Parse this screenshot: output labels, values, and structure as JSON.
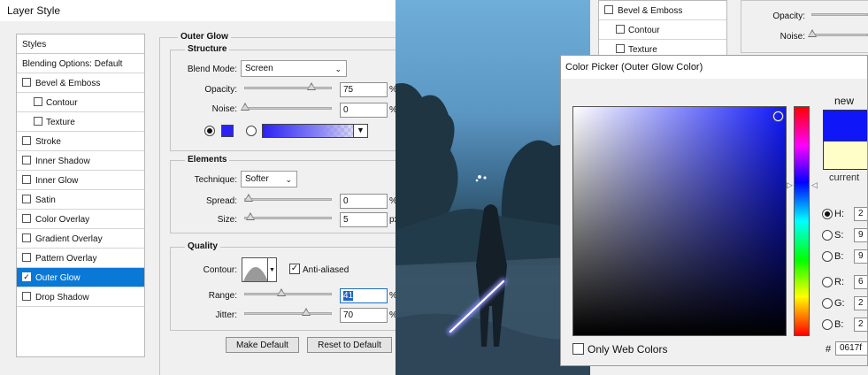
{
  "layer_style": {
    "title": "Layer Style",
    "styles_header": "Styles",
    "styles": [
      {
        "label": "Blending Options: Default"
      },
      {
        "label": "Bevel & Emboss",
        "checked": false
      },
      {
        "label": "Contour",
        "checked": false
      },
      {
        "label": "Texture",
        "checked": false
      },
      {
        "label": "Stroke",
        "checked": false
      },
      {
        "label": "Inner Shadow",
        "checked": false
      },
      {
        "label": "Inner Glow",
        "checked": false
      },
      {
        "label": "Satin",
        "checked": false
      },
      {
        "label": "Color Overlay",
        "checked": false
      },
      {
        "label": "Gradient Overlay",
        "checked": false
      },
      {
        "label": "Pattern Overlay",
        "checked": false
      },
      {
        "label": "Outer Glow",
        "checked": true,
        "selected": true
      },
      {
        "label": "Drop Shadow",
        "checked": false
      }
    ],
    "outer_glow": {
      "title": "Outer Glow",
      "structure": {
        "title": "Structure",
        "blend_mode_label": "Blend Mode:",
        "blend_mode": "Screen",
        "opacity_label": "Opacity:",
        "opacity": "75",
        "opacity_unit": "%",
        "noise_label": "Noise:",
        "noise": "0",
        "noise_unit": "%",
        "glow_color": "#2b22f3"
      },
      "elements": {
        "title": "Elements",
        "technique_label": "Technique:",
        "technique": "Softer",
        "spread_label": "Spread:",
        "spread": "0",
        "spread_unit": "%",
        "size_label": "Size:",
        "size": "5",
        "size_unit": "px"
      },
      "quality": {
        "title": "Quality",
        "contour_label": "Contour:",
        "anti_aliased_label": "Anti-aliased",
        "anti_aliased": true,
        "range_label": "Range:",
        "range": "41",
        "range_unit": "%",
        "jitter_label": "Jitter:",
        "jitter": "70",
        "jitter_unit": "%"
      },
      "make_default": "Make Default",
      "reset_default": "Reset to Default"
    }
  },
  "background_panel": {
    "styles": [
      "Bevel & Emboss",
      "Contour",
      "Texture"
    ],
    "opacity_label": "Opacity:",
    "noise_label": "Noise:"
  },
  "color_picker": {
    "title": "Color Picker (Outer Glow Color)",
    "new_label": "new",
    "current_label": "current",
    "new_color": "#0f17f9",
    "current_color": "#fffec8",
    "only_web_colors": "Only Web Colors",
    "hsb": [
      {
        "label": "H:",
        "value": "2",
        "selected": true
      },
      {
        "label": "S:",
        "value": "9"
      },
      {
        "label": "B:",
        "value": "9"
      }
    ],
    "rgb": [
      {
        "label": "R:",
        "value": "6"
      },
      {
        "label": "G:",
        "value": "2"
      },
      {
        "label": "B:",
        "value": "2"
      }
    ],
    "hex_label": "#",
    "hex": "0617f"
  }
}
